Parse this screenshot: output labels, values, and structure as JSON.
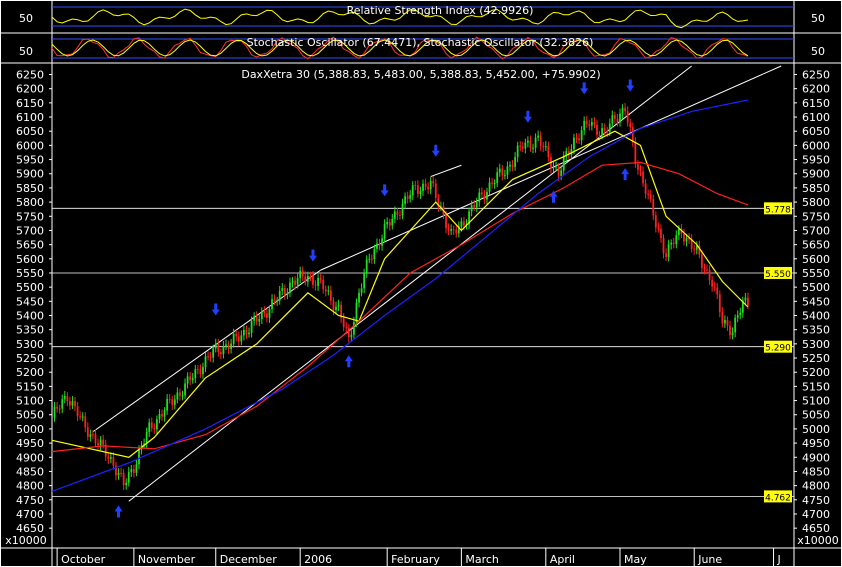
{
  "chart_data": {
    "type": "candlestick",
    "title": "DaxXetra 30 (5,388.83, 5,483.00, 5,388.83, 5,452.00, +75.9902)",
    "ylim": [
      4580,
      6280
    ],
    "y_ticks": [
      4650,
      4700,
      4750,
      4800,
      4850,
      4900,
      4950,
      5000,
      5050,
      5100,
      5150,
      5200,
      5250,
      5300,
      5350,
      5400,
      5450,
      5500,
      5550,
      5600,
      5650,
      5700,
      5750,
      5800,
      5850,
      5900,
      5950,
      6000,
      6050,
      6100,
      6150,
      6200,
      6250
    ],
    "y_tick_labels": [
      "4650",
      "4700",
      "4750",
      "4800",
      "4850",
      "4900",
      "4950",
      "5000",
      "5050",
      "5100",
      "5150",
      "5200",
      "5250",
      "5300",
      "5350",
      "5400",
      "5450",
      "5500",
      "5550",
      "5600",
      "5650",
      "5700",
      "5750",
      "5800",
      "5850",
      "5900",
      "5950",
      "6000",
      "6050",
      "6100",
      "6150",
      "6200",
      "6250"
    ],
    "scale_note": "x10000",
    "x_labels": [
      "October",
      "November",
      "December",
      "2006",
      "February",
      "March",
      "April",
      "May",
      "June",
      "J"
    ],
    "x_label_sessions": [
      2,
      32,
      64,
      97,
      131,
      160,
      193,
      222,
      251,
      282
    ],
    "n_sessions": 290,
    "horizontal_levels": [
      {
        "value": 4762,
        "label": "4.762"
      },
      {
        "value": 5290,
        "label": "5.290"
      },
      {
        "value": 5550,
        "label": "5.550"
      },
      {
        "value": 5778,
        "label": "5.778"
      }
    ],
    "price_keypoints": [
      [
        0,
        5040
      ],
      [
        6,
        5120
      ],
      [
        12,
        5020
      ],
      [
        18,
        4950
      ],
      [
        24,
        4880
      ],
      [
        28,
        4800
      ],
      [
        32,
        4870
      ],
      [
        38,
        5000
      ],
      [
        45,
        5080
      ],
      [
        52,
        5150
      ],
      [
        58,
        5220
      ],
      [
        64,
        5280
      ],
      [
        70,
        5300
      ],
      [
        76,
        5350
      ],
      [
        82,
        5400
      ],
      [
        88,
        5460
      ],
      [
        94,
        5520
      ],
      [
        100,
        5540
      ],
      [
        106,
        5500
      ],
      [
        112,
        5420
      ],
      [
        116,
        5310
      ],
      [
        120,
        5480
      ],
      [
        124,
        5600
      ],
      [
        130,
        5700
      ],
      [
        136,
        5780
      ],
      [
        142,
        5850
      ],
      [
        148,
        5860
      ],
      [
        152,
        5780
      ],
      [
        156,
        5680
      ],
      [
        160,
        5720
      ],
      [
        166,
        5800
      ],
      [
        172,
        5870
      ],
      [
        178,
        5920
      ],
      [
        184,
        6000
      ],
      [
        190,
        6020
      ],
      [
        194,
        5960
      ],
      [
        198,
        5900
      ],
      [
        204,
        6020
      ],
      [
        210,
        6080
      ],
      [
        216,
        6040
      ],
      [
        220,
        6100
      ],
      [
        224,
        6130
      ],
      [
        228,
        5950
      ],
      [
        232,
        5850
      ],
      [
        236,
        5720
      ],
      [
        240,
        5620
      ],
      [
        246,
        5700
      ],
      [
        252,
        5620
      ],
      [
        258,
        5520
      ],
      [
        262,
        5380
      ],
      [
        266,
        5350
      ],
      [
        270,
        5440
      ],
      [
        272,
        5452
      ]
    ],
    "series": [
      {
        "name": "",
        "color": "#ffff00",
        "points": [
          [
            0,
            4960
          ],
          [
            30,
            4900
          ],
          [
            40,
            4970
          ],
          [
            60,
            5180
          ],
          [
            80,
            5300
          ],
          [
            100,
            5480
          ],
          [
            112,
            5400
          ],
          [
            120,
            5380
          ],
          [
            130,
            5600
          ],
          [
            150,
            5800
          ],
          [
            160,
            5700
          ],
          [
            180,
            5880
          ],
          [
            200,
            5960
          ],
          [
            220,
            6050
          ],
          [
            230,
            6000
          ],
          [
            240,
            5750
          ],
          [
            252,
            5650
          ],
          [
            262,
            5520
          ],
          [
            272,
            5430
          ]
        ]
      },
      {
        "name": "",
        "color": "#ff2020",
        "points": [
          [
            0,
            4920
          ],
          [
            20,
            4940
          ],
          [
            40,
            4930
          ],
          [
            60,
            4980
          ],
          [
            80,
            5080
          ],
          [
            100,
            5220
          ],
          [
            120,
            5380
          ],
          [
            140,
            5550
          ],
          [
            160,
            5650
          ],
          [
            180,
            5760
          ],
          [
            200,
            5850
          ],
          [
            215,
            5930
          ],
          [
            230,
            5940
          ],
          [
            245,
            5900
          ],
          [
            260,
            5830
          ],
          [
            272,
            5790
          ]
        ]
      },
      {
        "name": "",
        "color": "#2020ff",
        "points": [
          [
            0,
            4780
          ],
          [
            30,
            4880
          ],
          [
            60,
            5000
          ],
          [
            90,
            5140
          ],
          [
            110,
            5260
          ],
          [
            130,
            5400
          ],
          [
            150,
            5530
          ],
          [
            170,
            5680
          ],
          [
            190,
            5830
          ],
          [
            210,
            5960
          ],
          [
            230,
            6060
          ],
          [
            250,
            6120
          ],
          [
            272,
            6160
          ]
        ]
      }
    ],
    "trend_lines": [
      [
        [
          30,
          4745
        ],
        [
          250,
          6280
        ]
      ],
      [
        [
          16,
          4990
        ],
        [
          105,
          5560
        ]
      ],
      [
        [
          105,
          5560
        ],
        [
          285,
          6280
        ]
      ],
      [
        [
          148,
          5890
        ],
        [
          160,
          5930
        ]
      ]
    ],
    "arrows_down": [
      [
        64,
        5400
      ],
      [
        102,
        5590
      ],
      [
        130,
        5820
      ],
      [
        150,
        5960
      ],
      [
        186,
        6080
      ],
      [
        208,
        6180
      ],
      [
        226,
        6190
      ]
    ],
    "arrows_up": [
      [
        26,
        4730
      ],
      [
        116,
        5260
      ],
      [
        196,
        5840
      ],
      [
        224,
        5920
      ]
    ],
    "rsi": {
      "title": "Relative Strength Index (42.9926)",
      "level_label": "50"
    },
    "stochastic": {
      "title": "Stochastic Oscillator (67.4471), Stochastic Oscillator (32.3826)",
      "level_label": "50"
    }
  }
}
